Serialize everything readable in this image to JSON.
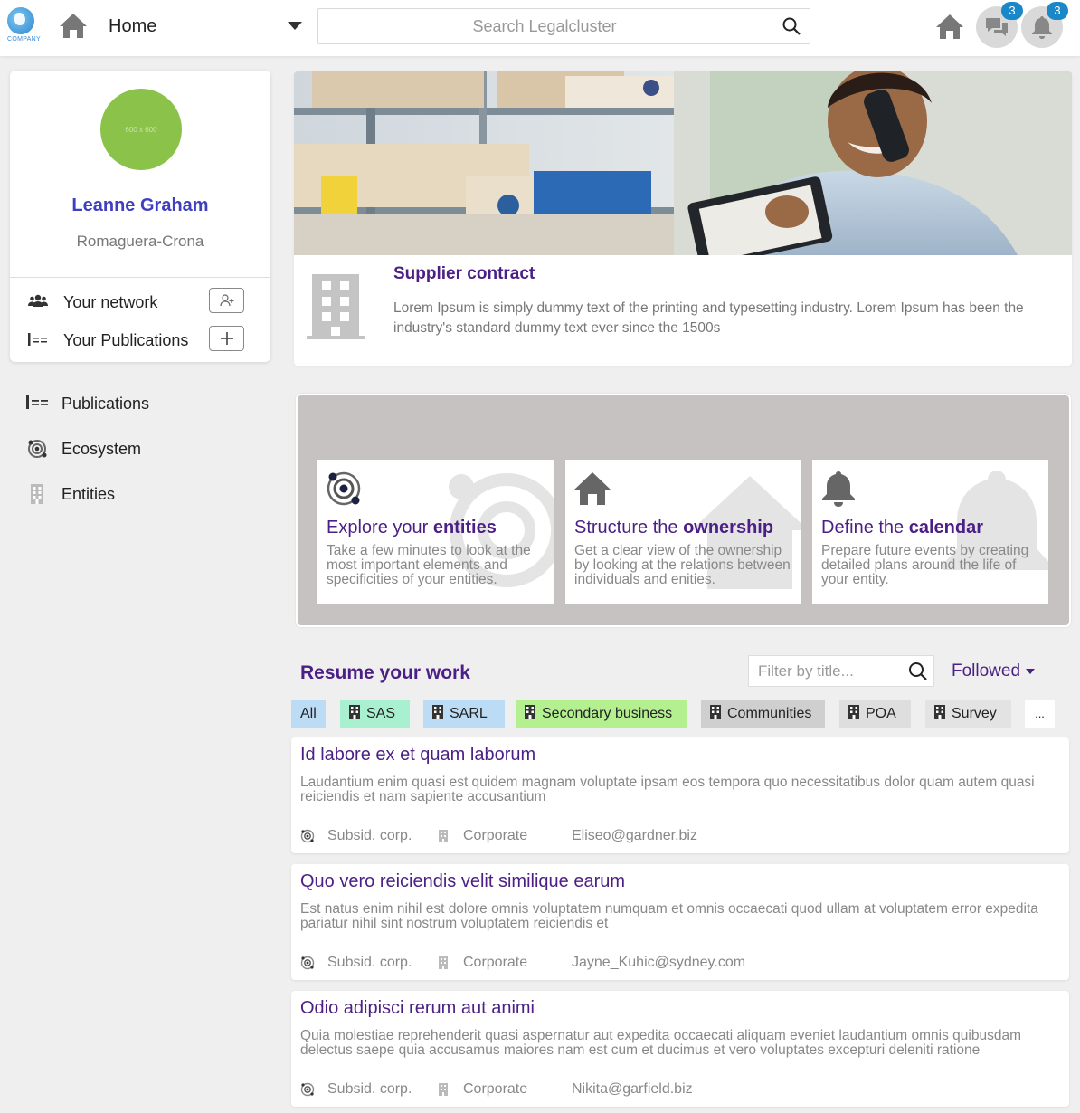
{
  "header": {
    "logo_text": "COMPANY",
    "home_label": "Home",
    "search_placeholder": "Search Legalcluster",
    "messages_badge": "3",
    "notifications_badge": "3"
  },
  "profile": {
    "avatar_text": "600 x 600",
    "name": "Leanne Graham",
    "company": "Romaguera-Crona",
    "network_label": "Your network",
    "publications_label": "Your Publications"
  },
  "nav": {
    "items": [
      {
        "label": "Publications",
        "icon": "list-icon"
      },
      {
        "label": "Ecosystem",
        "icon": "orbit-icon"
      },
      {
        "label": "Entities",
        "icon": "building-icon"
      }
    ]
  },
  "hero": {
    "title": "Supplier contract",
    "text": "Lorem Ipsum is simply dummy text of the printing and typesetting industry. Lorem Ipsum has been the industry's standard dummy text ever since the 1500s"
  },
  "features": [
    {
      "title_prefix": "Explore your ",
      "title_bold": "entities",
      "text": "Take a few minutes to look at the most important elements and specificities of your entities.",
      "icon": "orbit-icon"
    },
    {
      "title_prefix": "Structure the ",
      "title_bold": "ownership",
      "text": "Get a clear view of the ownership by looking at the relations between individuals and enities.",
      "icon": "home-icon"
    },
    {
      "title_prefix": "Define the ",
      "title_bold": "calendar",
      "text": "Prepare future events by creating detailed plans around the life of your entity.",
      "icon": "bell-icon"
    }
  ],
  "resume": {
    "title": "Resume your work",
    "filter_placeholder": "Filter by title...",
    "followed_label": "Followed",
    "chips": [
      {
        "label": "All",
        "color": "#bcdcf5"
      },
      {
        "label": "SAS",
        "color": "#a8f0d0"
      },
      {
        "label": "SARL",
        "color": "#bcdcf5"
      },
      {
        "label": "Secondary business",
        "color": "#b4ef90"
      },
      {
        "label": "Communities",
        "color": "#cfcfcf"
      },
      {
        "label": "POA",
        "color": "#dedede"
      },
      {
        "label": "Survey",
        "color": "#e3e3e3"
      },
      {
        "label": "...",
        "color": "#ffffff"
      }
    ],
    "items": [
      {
        "title": "Id labore ex et quam laborum",
        "desc": "Laudantium enim quasi est quidem magnam voluptate ipsam eos tempora quo necessitatibus dolor quam autem quasi reiciendis et nam sapiente accusantium",
        "type": "Subsid. corp.",
        "category": "Corporate",
        "email": "Eliseo@gardner.biz"
      },
      {
        "title": "Quo vero reiciendis velit similique earum",
        "desc": "Est natus enim nihil est dolore omnis voluptatem numquam et omnis occaecati quod ullam at voluptatem error expedita pariatur nihil sint nostrum voluptatem reiciendis et",
        "type": "Subsid. corp.",
        "category": "Corporate",
        "email": "Jayne_Kuhic@sydney.com"
      },
      {
        "title": "Odio adipisci rerum aut animi",
        "desc": "Quia molestiae reprehenderit quasi aspernatur aut expedita occaecati aliquam eveniet laudantium omnis quibusdam delectus saepe quia accusamus maiores nam est cum et ducimus et vero voluptates excepturi deleniti ratione",
        "type": "Subsid. corp.",
        "category": "Corporate",
        "email": "Nikita@garfield.biz"
      }
    ]
  },
  "colors": {
    "accent_purple": "#4b1f86",
    "name_blue": "#3f3fc0",
    "badge_blue": "#1987c8",
    "avatar_green": "#8bc34a",
    "panel_grey": "#c6c2c2"
  }
}
